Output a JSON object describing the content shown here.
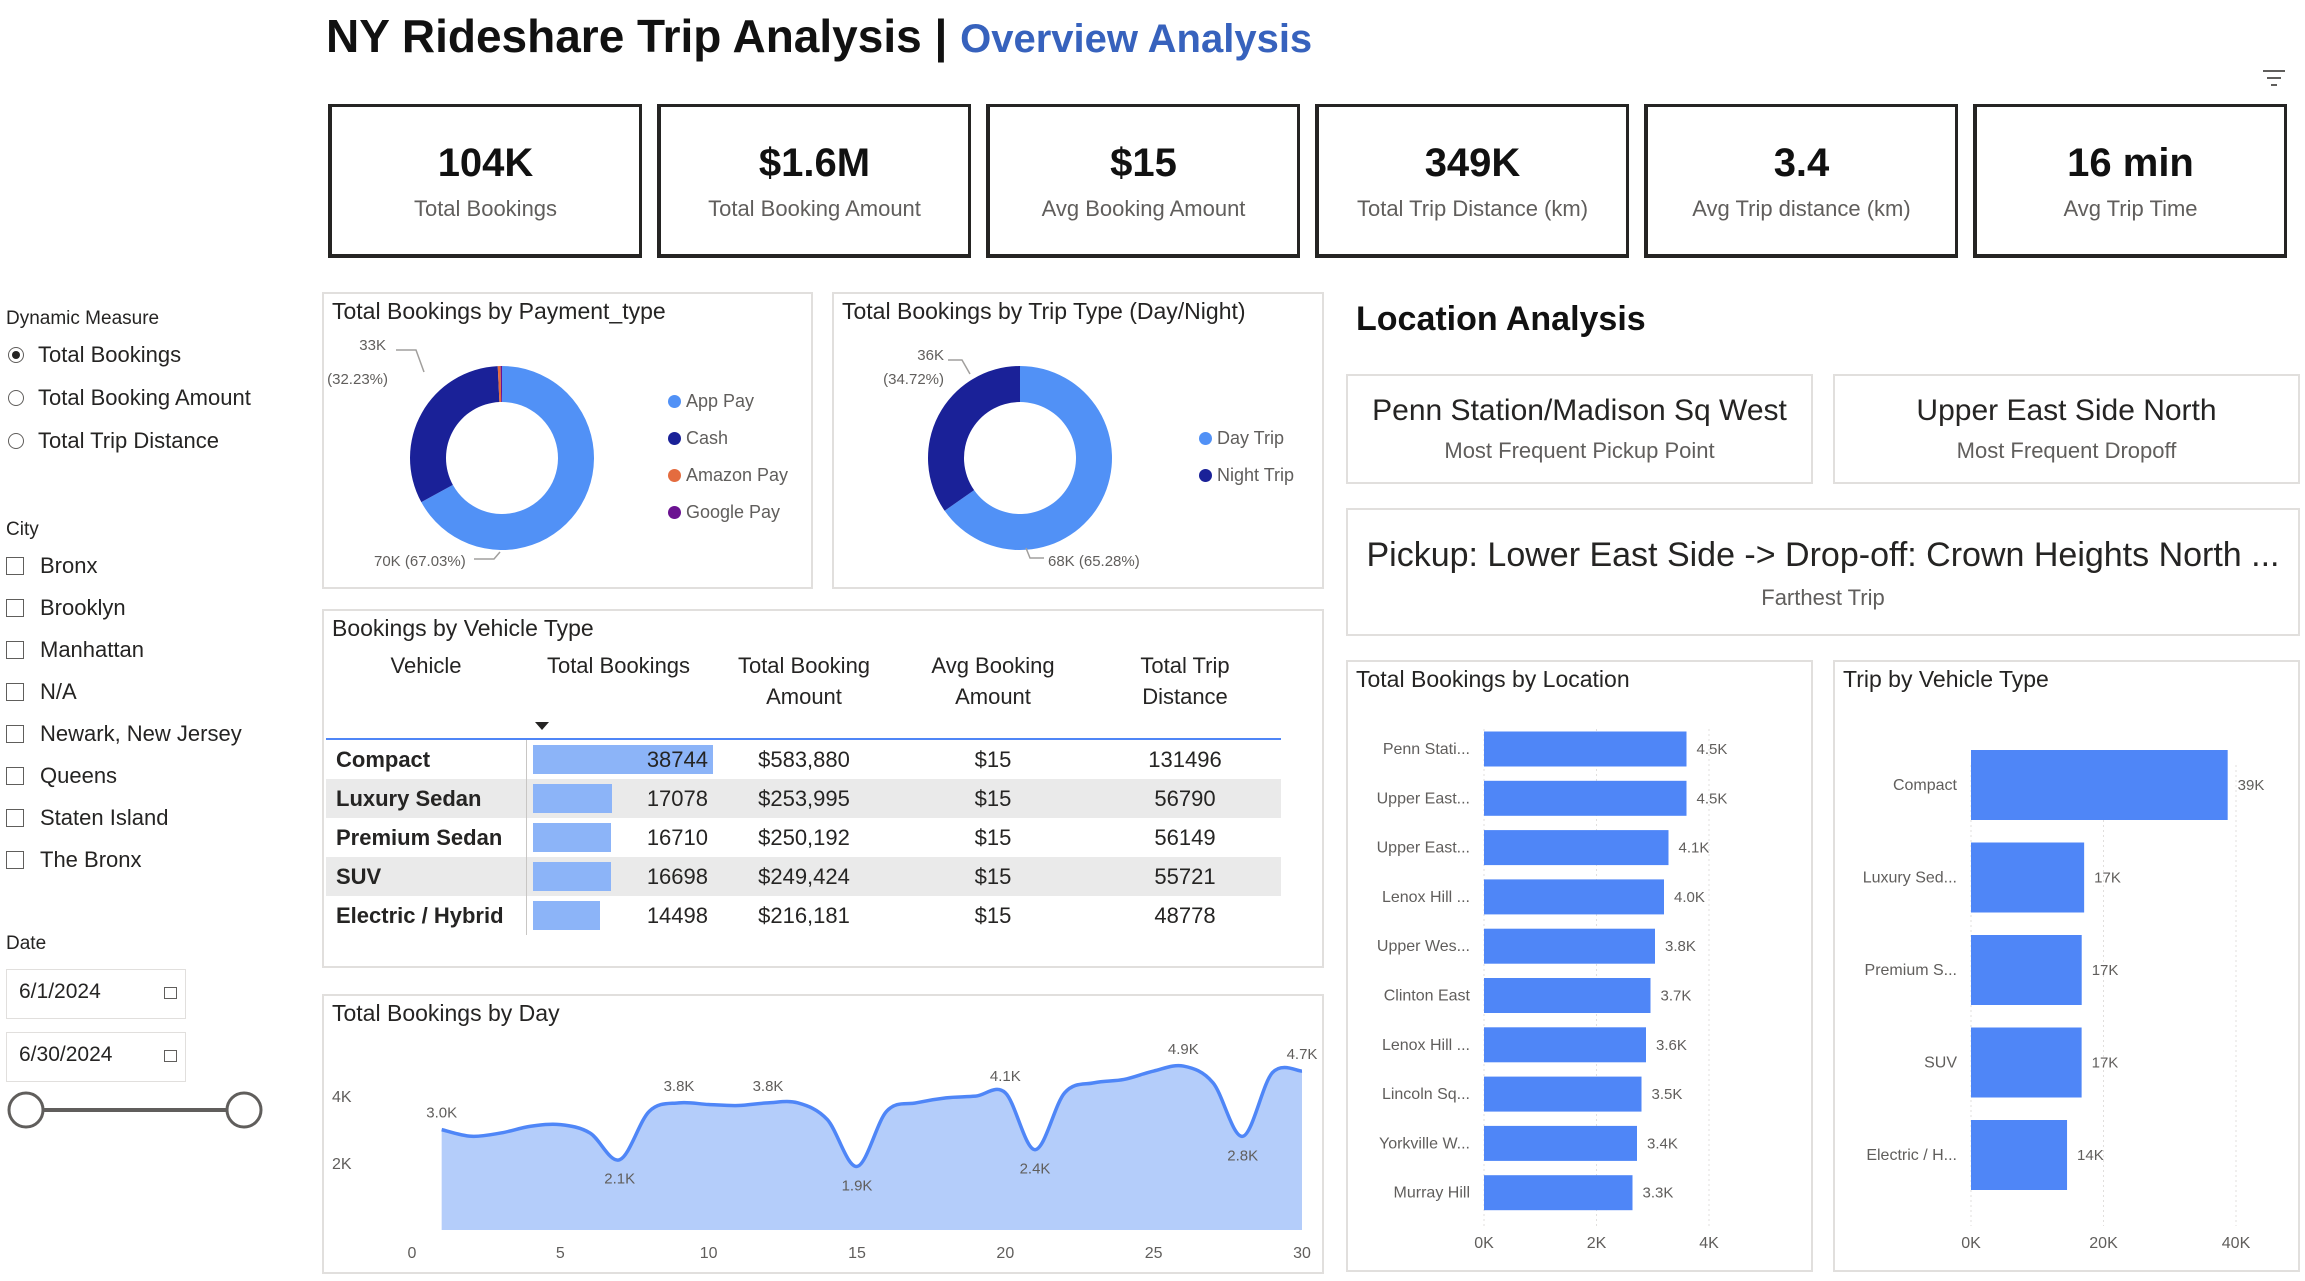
{
  "header": {
    "title": "NY Rideshare Trip Analysis",
    "separator": "|",
    "subtitle": "Overview Analysis"
  },
  "kpis": [
    {
      "value": "104K",
      "label": "Total Bookings"
    },
    {
      "value": "$1.6M",
      "label": "Total Booking Amount"
    },
    {
      "value": "$15",
      "label": "Avg Booking Amount"
    },
    {
      "value": "349K",
      "label": "Total Trip Distance (km)"
    },
    {
      "value": "3.4",
      "label": "Avg Trip distance (km)"
    },
    {
      "value": "16 min",
      "label": "Avg Trip Time"
    }
  ],
  "slicers": {
    "measure": {
      "title": "Dynamic Measure",
      "options": [
        "Total Bookings",
        "Total Booking Amount",
        "Total Trip Distance"
      ],
      "selected": "Total Bookings"
    },
    "city": {
      "title": "City",
      "options": [
        "Bronx",
        "Brooklyn",
        "Manhattan",
        "N/A",
        "Newark, New Jersey",
        "Queens",
        "Staten Island",
        "The Bronx"
      ]
    },
    "date": {
      "title": "Date",
      "start": "6/1/2024",
      "end": "6/30/2024"
    }
  },
  "payment_chart": {
    "title": "Total Bookings by Payment_type",
    "top_label": "33K",
    "top_pct": "(32.23%)",
    "bottom_label": "70K (67.03%)",
    "legend": [
      {
        "name": "App Pay",
        "color": "#5191f6"
      },
      {
        "name": "Cash",
        "color": "#1a2198"
      },
      {
        "name": "Amazon Pay",
        "color": "#e46c3f"
      },
      {
        "name": "Google Pay",
        "color": "#6b1291"
      }
    ]
  },
  "triptype_chart": {
    "title": "Total Bookings by Trip Type (Day/Night)",
    "top_label": "36K",
    "top_pct": "(34.72%)",
    "bottom_label": "68K (65.28%)",
    "legend": [
      {
        "name": "Day Trip",
        "color": "#5191f6"
      },
      {
        "name": "Night Trip",
        "color": "#1a2198"
      }
    ]
  },
  "vehicle_table": {
    "title": "Bookings by Vehicle Type",
    "columns": [
      {
        "line1": "Vehicle",
        "line2": ""
      },
      {
        "line1": "Total Bookings",
        "line2": ""
      },
      {
        "line1": "Total Booking",
        "line2": "Amount"
      },
      {
        "line1": "Avg Booking",
        "line2": "Amount"
      },
      {
        "line1": "Total Trip",
        "line2": "Distance"
      }
    ],
    "rows": [
      {
        "vehicle": "Compact",
        "bookings": "38744",
        "bookings_value": 38744,
        "amount": "$583,880",
        "avg": "$15",
        "distance": "131496"
      },
      {
        "vehicle": "Luxury Sedan",
        "bookings": "17078",
        "bookings_value": 17078,
        "amount": "$253,995",
        "avg": "$15",
        "distance": "56790"
      },
      {
        "vehicle": "Premium Sedan",
        "bookings": "16710",
        "bookings_value": 16710,
        "amount": "$250,192",
        "avg": "$15",
        "distance": "56149"
      },
      {
        "vehicle": "SUV",
        "bookings": "16698",
        "bookings_value": 16698,
        "amount": "$249,424",
        "avg": "$15",
        "distance": "55721"
      },
      {
        "vehicle": "Electric / Hybrid",
        "bookings": "14498",
        "bookings_value": 14498,
        "amount": "$216,181",
        "avg": "$15",
        "distance": "48778"
      }
    ]
  },
  "location": {
    "title": "Location Analysis",
    "pickup": {
      "value": "Penn Station/Madison Sq West",
      "label": "Most Frequent Pickup Point"
    },
    "dropoff": {
      "value": "Upper East Side North",
      "label": "Most Frequent Dropoff"
    },
    "farthest": {
      "value": "Pickup: Lower East Side -> Drop-off: Crown Heights North ...",
      "label": "Farthest Trip"
    }
  },
  "colors": {
    "bar": "#4f86f7",
    "donut_light": "#5191f6",
    "donut_dark": "#1a2198",
    "area_line": "#4f86f7",
    "area_fill": "#b4cdfa",
    "title_accent": "#3762bd"
  },
  "chart_data": [
    {
      "type": "pie",
      "title": "Total Bookings by Payment_type",
      "categories": [
        "App Pay",
        "Cash",
        "Amazon Pay",
        "Google Pay"
      ],
      "values": [
        67.03,
        32.23,
        0.5,
        0.24
      ],
      "unit": "%"
    },
    {
      "type": "pie",
      "title": "Total Bookings by Trip Type (Day/Night)",
      "categories": [
        "Day Trip",
        "Night Trip"
      ],
      "values": [
        65.28,
        34.72
      ],
      "unit": "%"
    },
    {
      "type": "area",
      "title": "Total Bookings by Day",
      "x": [
        1,
        2,
        3,
        4,
        5,
        6,
        7,
        8,
        9,
        10,
        11,
        12,
        13,
        14,
        15,
        16,
        17,
        18,
        19,
        20,
        21,
        22,
        23,
        24,
        25,
        26,
        27,
        28,
        29,
        30
      ],
      "y": [
        3000,
        2800,
        2900,
        3100,
        3150,
        2900,
        2100,
        3550,
        3800,
        3750,
        3720,
        3800,
        3800,
        3300,
        1900,
        3550,
        3800,
        3950,
        4000,
        4100,
        2400,
        4100,
        4400,
        4500,
        4750,
        4900,
        4400,
        2800,
        4700,
        4750
      ],
      "point_labels": [
        {
          "x": 1,
          "text": "3.0K"
        },
        {
          "x": 7,
          "text": "2.1K"
        },
        {
          "x": 9,
          "text": "3.8K"
        },
        {
          "x": 12,
          "text": "3.8K"
        },
        {
          "x": 15,
          "text": "1.9K"
        },
        {
          "x": 20,
          "text": "4.1K"
        },
        {
          "x": 21,
          "text": "2.4K"
        },
        {
          "x": 26,
          "text": "4.9K"
        },
        {
          "x": 28,
          "text": "2.8K"
        },
        {
          "x": 30,
          "text": "4.7K"
        }
      ],
      "xticks": [
        "0",
        "5",
        "10",
        "15",
        "20",
        "25",
        "30"
      ],
      "yticks": [
        "2K",
        "4K"
      ],
      "xlim": [
        0,
        30
      ],
      "ylim": [
        0,
        5200
      ]
    },
    {
      "type": "bar",
      "orientation": "horizontal",
      "title": "Total Bookings by Location",
      "categories": [
        "Penn Stati...",
        "Upper East...",
        "Upper East...",
        "Lenox Hill ...",
        "Upper Wes...",
        "Clinton East",
        "Lenox Hill ...",
        "Lincoln Sq...",
        "Yorkville W...",
        "Murray Hill"
      ],
      "values": [
        4500,
        4500,
        4100,
        4000,
        3800,
        3700,
        3600,
        3500,
        3400,
        3300
      ],
      "value_labels": [
        "4.5K",
        "4.5K",
        "4.1K",
        "4.0K",
        "3.8K",
        "3.7K",
        "3.6K",
        "3.5K",
        "3.4K",
        "3.3K"
      ],
      "xticks": [
        "0K",
        "2K",
        "4K"
      ],
      "xlim": [
        0,
        5000
      ]
    },
    {
      "type": "bar",
      "orientation": "horizontal",
      "title": "Trip by Vehicle Type",
      "categories": [
        "Compact",
        "Luxury Sed...",
        "Premium S...",
        "SUV",
        "Electric / H..."
      ],
      "values": [
        38744,
        17078,
        16710,
        16698,
        14498
      ],
      "value_labels": [
        "39K",
        "17K",
        "17K",
        "17K",
        "14K"
      ],
      "xticks": [
        "0K",
        "20K",
        "40K"
      ],
      "xlim": [
        0,
        40000
      ]
    }
  ]
}
